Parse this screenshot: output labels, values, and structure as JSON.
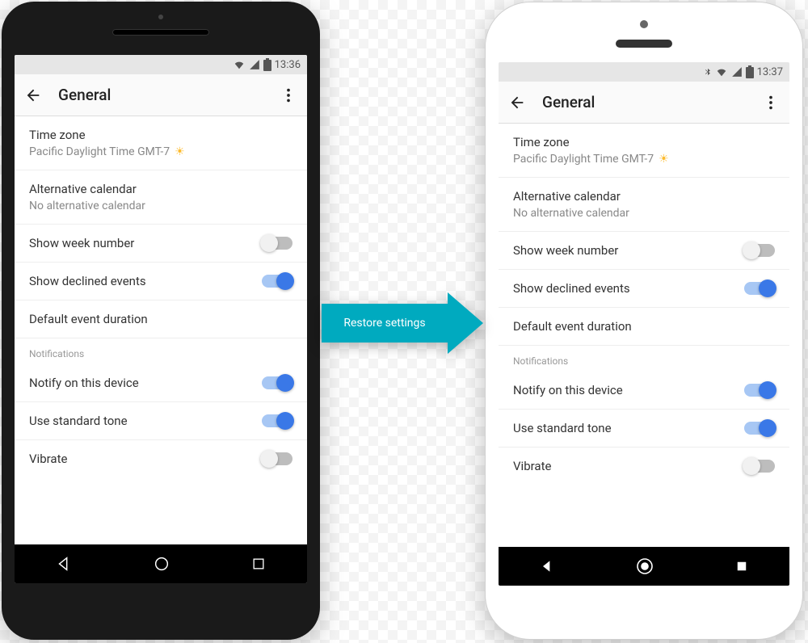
{
  "arrow_label": "Restore settings",
  "phones": {
    "left": {
      "status": {
        "time": "13:36",
        "bluetooth": false
      },
      "toolbar": {
        "title": "General"
      },
      "settings": {
        "timezone_label": "Time zone",
        "timezone_value": "Pacific Daylight Time  GMT-7",
        "altcal_label": "Alternative calendar",
        "altcal_value": "No alternative calendar",
        "week_number_label": "Show week number",
        "week_number_on": false,
        "declined_label": "Show declined events",
        "declined_on": true,
        "event_duration_label": "Default event duration",
        "notifications_header": "Notifications",
        "notify_device_label": "Notify on this device",
        "notify_device_on": true,
        "standard_tone_label": "Use standard tone",
        "standard_tone_on": true,
        "vibrate_label": "Vibrate",
        "vibrate_on": false
      }
    },
    "right": {
      "status": {
        "time": "13:37",
        "bluetooth": true
      },
      "toolbar": {
        "title": "General"
      },
      "settings": {
        "timezone_label": "Time zone",
        "timezone_value": "Pacific Daylight Time  GMT-7",
        "altcal_label": "Alternative calendar",
        "altcal_value": "No alternative calendar",
        "week_number_label": "Show week number",
        "week_number_on": false,
        "declined_label": "Show declined events",
        "declined_on": true,
        "event_duration_label": "Default event duration",
        "notifications_header": "Notifications",
        "notify_device_label": "Notify on this device",
        "notify_device_on": true,
        "standard_tone_label": "Use standard tone",
        "standard_tone_on": true,
        "vibrate_label": "Vibrate",
        "vibrate_on": false
      }
    }
  }
}
